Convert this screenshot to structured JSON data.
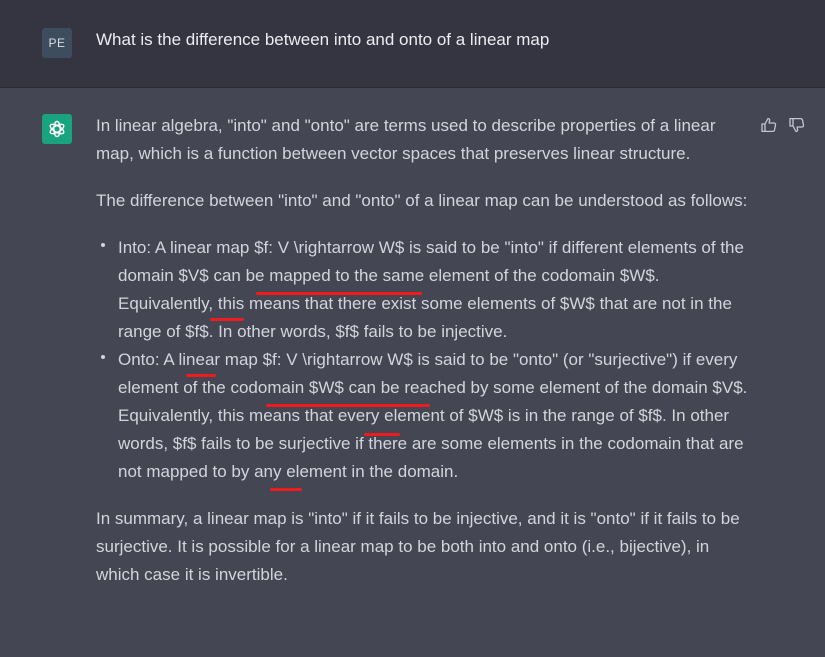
{
  "user": {
    "avatar_initials": "PE",
    "message": "What is the difference between into and onto of a linear map"
  },
  "assistant": {
    "avatar_icon": "openai-logo-icon",
    "paragraphs": {
      "intro": "In linear algebra, \"into\" and \"onto\" are terms used to describe properties of a linear map, which is a function between vector spaces that preserves linear structure.",
      "lead": "The difference between \"into\" and \"onto\" of a linear map can be understood as follows:",
      "summary": "In summary, a linear map is \"into\" if it fails to be injective, and it is \"onto\" if it fails to be surjective. It is possible for a linear map to be both into and onto (i.e., bijective), in which case it is invertible."
    },
    "bullets": [
      "Into: A linear map $f: V \\rightarrow W$ is said to be \"into\" if different elements of the domain $V$ can be mapped to the same element of the codomain $W$. Equivalently, this means that there exist some elements of $W$ that are not in the range of $f$. In other words, $f$ fails to be injective.",
      "Onto: A linear map $f: V \\rightarrow W$ is said to be \"onto\" (or \"surjective\") if every element of the codomain $W$ can be reached by some element of the domain $V$. Equivalently, this means that every element of $W$ is in the range of $f$. In other words, $f$ fails to be surjective if there are some elements in the codomain that are not mapped to by any element in the domain."
    ],
    "feedback": {
      "thumbs_up_icon": "thumbs-up-icon",
      "thumbs_down_icon": "thumbs-down-icon"
    }
  },
  "colors": {
    "user_bg": "#343541",
    "assistant_bg": "#444654",
    "bot_avatar": "#19a37f",
    "annotation_underline": "#f01c1c"
  }
}
